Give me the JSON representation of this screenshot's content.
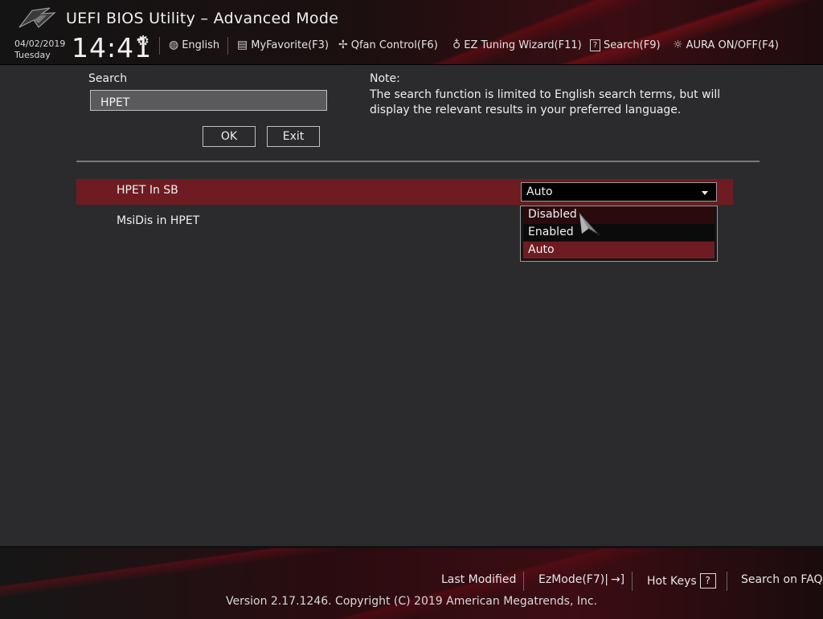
{
  "header": {
    "title": "UEFI BIOS Utility – Advanced Mode",
    "date": "04/02/2019",
    "day": "Tuesday",
    "time": "14:41",
    "language": "English",
    "my_favorite": "MyFavorite(F3)",
    "qfan": "Qfan Control(F6)",
    "ez_tuning": "EZ Tuning Wizard(F11)",
    "search": "Search(F9)",
    "aura": "AURA ON/OFF(F4)"
  },
  "search_panel": {
    "label": "Search",
    "value": "HPET",
    "ok_label": "OK",
    "exit_label": "Exit",
    "note_title": "Note:",
    "note_text": "The search function is limited to English search terms, but will display the relevant results in your preferred language."
  },
  "results": [
    {
      "label": "HPET In SB",
      "value": "Auto",
      "selected": true
    },
    {
      "label": "MsiDis in HPET",
      "selected": false
    }
  ],
  "dropdown": {
    "options": [
      "Disabled",
      "Enabled",
      "Auto"
    ],
    "highlighted": "Auto"
  },
  "footer": {
    "last_modified": "Last Modified",
    "ez_mode": "EzMode(F7)|",
    "hot_keys": "Hot Keys",
    "hot_keys_key": "?",
    "faq": "Search on FAQ",
    "copyright": "Version 2.17.1246. Copyright (C) 2019 American Megatrends, Inc."
  },
  "colors": {
    "accent_red": "#6e1c22",
    "background": "#2b2b2d"
  }
}
